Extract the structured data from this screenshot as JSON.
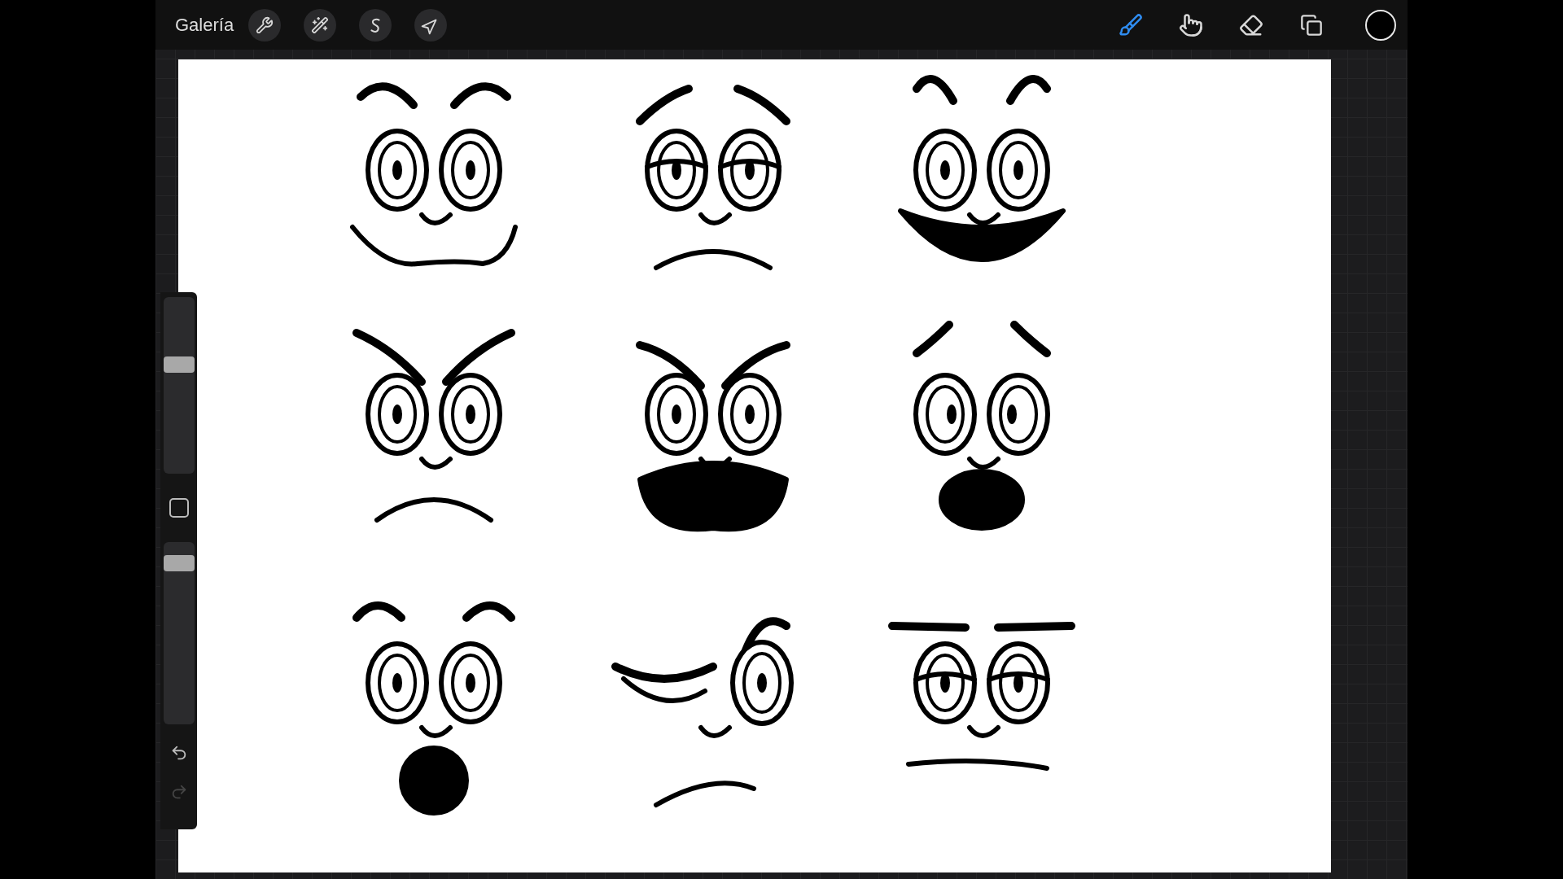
{
  "toolbar": {
    "gallery_label": "Galería",
    "left_tools": [
      {
        "kind": "wrench"
      },
      {
        "kind": "wand"
      },
      {
        "kind": "selection"
      },
      {
        "kind": "transform"
      }
    ],
    "right_tools": [
      {
        "kind": "brush",
        "selected": true
      },
      {
        "kind": "smudge",
        "selected": false
      },
      {
        "kind": "eraser",
        "selected": false
      },
      {
        "kind": "layers",
        "selected": false
      }
    ],
    "color": {
      "color": "#000000"
    }
  },
  "sidebar": {
    "brush_size": {
      "level": 0.63
    },
    "opacity": {
      "level": 0.92
    },
    "redo": {
      "disabled": true
    }
  }
}
